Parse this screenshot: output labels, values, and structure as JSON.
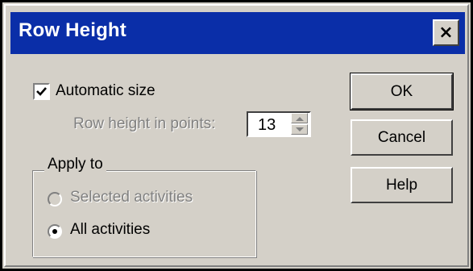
{
  "window": {
    "title": "Row Height",
    "close_symbol": "×"
  },
  "automatic_size": {
    "label": "Automatic size",
    "checked": true
  },
  "row_height": {
    "label": "Row height in points:",
    "value": "13",
    "enabled": false
  },
  "apply_to": {
    "group_label": "Apply to",
    "options": [
      {
        "label": "Selected activities",
        "selected": false,
        "enabled": false
      },
      {
        "label": "All activities",
        "selected": true,
        "enabled": true
      }
    ]
  },
  "buttons": {
    "ok": "OK",
    "cancel": "Cancel",
    "help": "Help"
  },
  "colors": {
    "title_bar": "#0a2ea8",
    "dialog_face": "#d4d0c8",
    "disabled_text": "#808080"
  }
}
